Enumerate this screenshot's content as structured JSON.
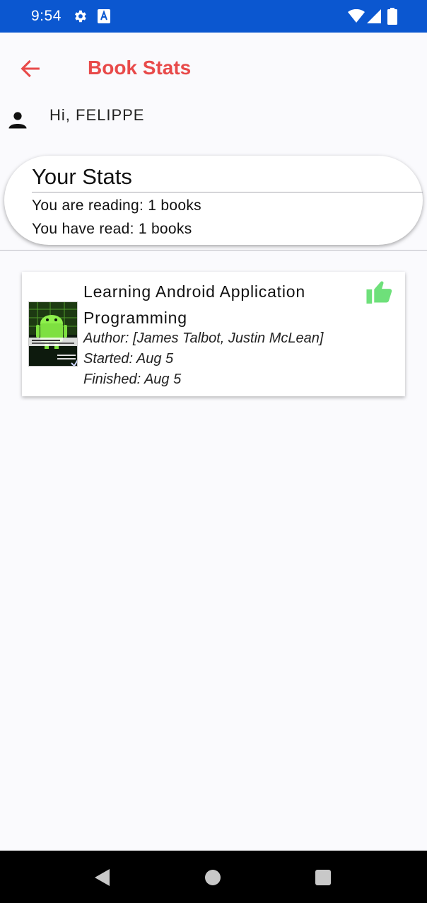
{
  "status_bar": {
    "time": "9:54",
    "icons": [
      "settings-gear-icon",
      "accessibility-a-icon",
      "wifi-icon",
      "cell-signal-icon",
      "battery-icon"
    ]
  },
  "header": {
    "title": "Book Stats",
    "back_icon": "arrow-left-icon"
  },
  "greeting": {
    "text": "Hi, FELIPPE",
    "icon": "person-icon"
  },
  "stats": {
    "title": "Your Stats",
    "reading": "You are reading: 1 books",
    "read": "You have read: 1 books"
  },
  "books": [
    {
      "title": "Learning Android Application Programming",
      "author": "Author: [James Talbot, Justin McLean]",
      "started": "Started: Aug 5",
      "finished": "Finished: Aug 5",
      "status_icon": "thumbs-up-icon"
    }
  ],
  "colors": {
    "status_bar": "#0b57d0",
    "accent": "#e84a4a",
    "thumb": "#6ee07a",
    "background": "#fafafd"
  },
  "nav_bar": {
    "icons": [
      "back-triangle-icon",
      "home-circle-icon",
      "recents-square-icon"
    ]
  }
}
